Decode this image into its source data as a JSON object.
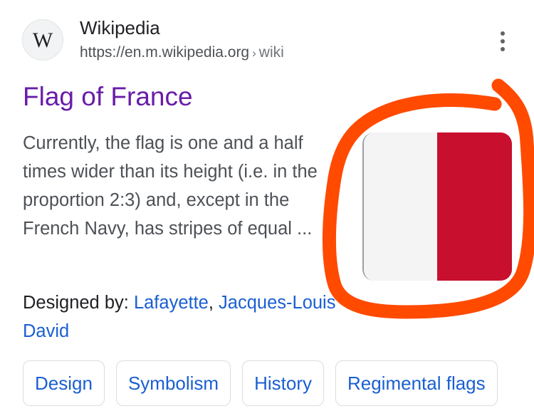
{
  "source": {
    "favicon_letter": "W",
    "name": "Wikipedia",
    "url": "https://en.m.wikipedia.org",
    "separator": "›",
    "path": "wiki"
  },
  "result": {
    "title": "Flag of France",
    "snippet": "Currently, the flag is one and a half times wider than its height (i.e. in the proportion 2:3) and, except in the French Navy, has stripes of equal ...",
    "attribution": {
      "label": "Designed by:",
      "designers": [
        "Lafayette",
        "Jacques-Louis David"
      ],
      "separator": ","
    },
    "thumbnail": {
      "stripe_colors": [
        "#f4f4f5",
        "#c8102e"
      ]
    }
  },
  "chips": [
    "Design",
    "Symbolism",
    "History",
    "Regimental flags"
  ],
  "colors": {
    "title": "#681da8",
    "link": "#1a5fd1",
    "annotation": "#ff4a00"
  },
  "icons": {
    "menu": "more-vert-icon",
    "site": "wikipedia-logo-icon"
  }
}
